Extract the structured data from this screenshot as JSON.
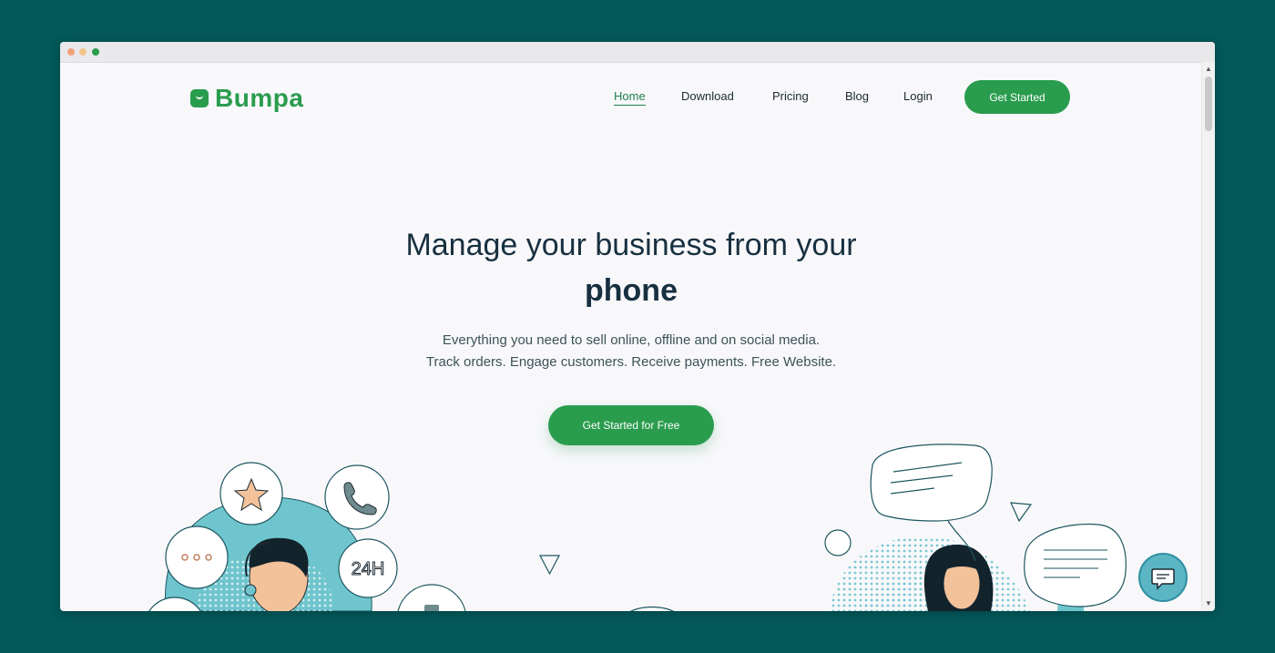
{
  "brand": {
    "name": "Bumpa",
    "color": "#2a9c4e"
  },
  "nav": {
    "items": [
      {
        "label": "Home",
        "active": true
      },
      {
        "label": "Download",
        "active": false
      },
      {
        "label": "Pricing",
        "active": false
      },
      {
        "label": "Blog",
        "active": false
      },
      {
        "label": "Login",
        "active": false
      }
    ],
    "cta_label": "Get Started"
  },
  "hero": {
    "title_line1": "Manage your business from your",
    "title_line2": "phone",
    "subtitle_line1": "Everything you need to sell online, offline and on social media.",
    "subtitle_line2": "Track orders. Engage customers. Receive payments. Free Website.",
    "cta_label": "Get Started for Free"
  },
  "illustration": {
    "badge_24h": "24H",
    "icons": [
      "star-icon",
      "phone-icon",
      "chat-dots-icon",
      "speech-bubble-icon",
      "chat-widget-icon"
    ]
  },
  "colors": {
    "background": "#03585a",
    "accent": "#2a9c4e",
    "heading": "#173040",
    "teal": "#6fc5cd"
  }
}
